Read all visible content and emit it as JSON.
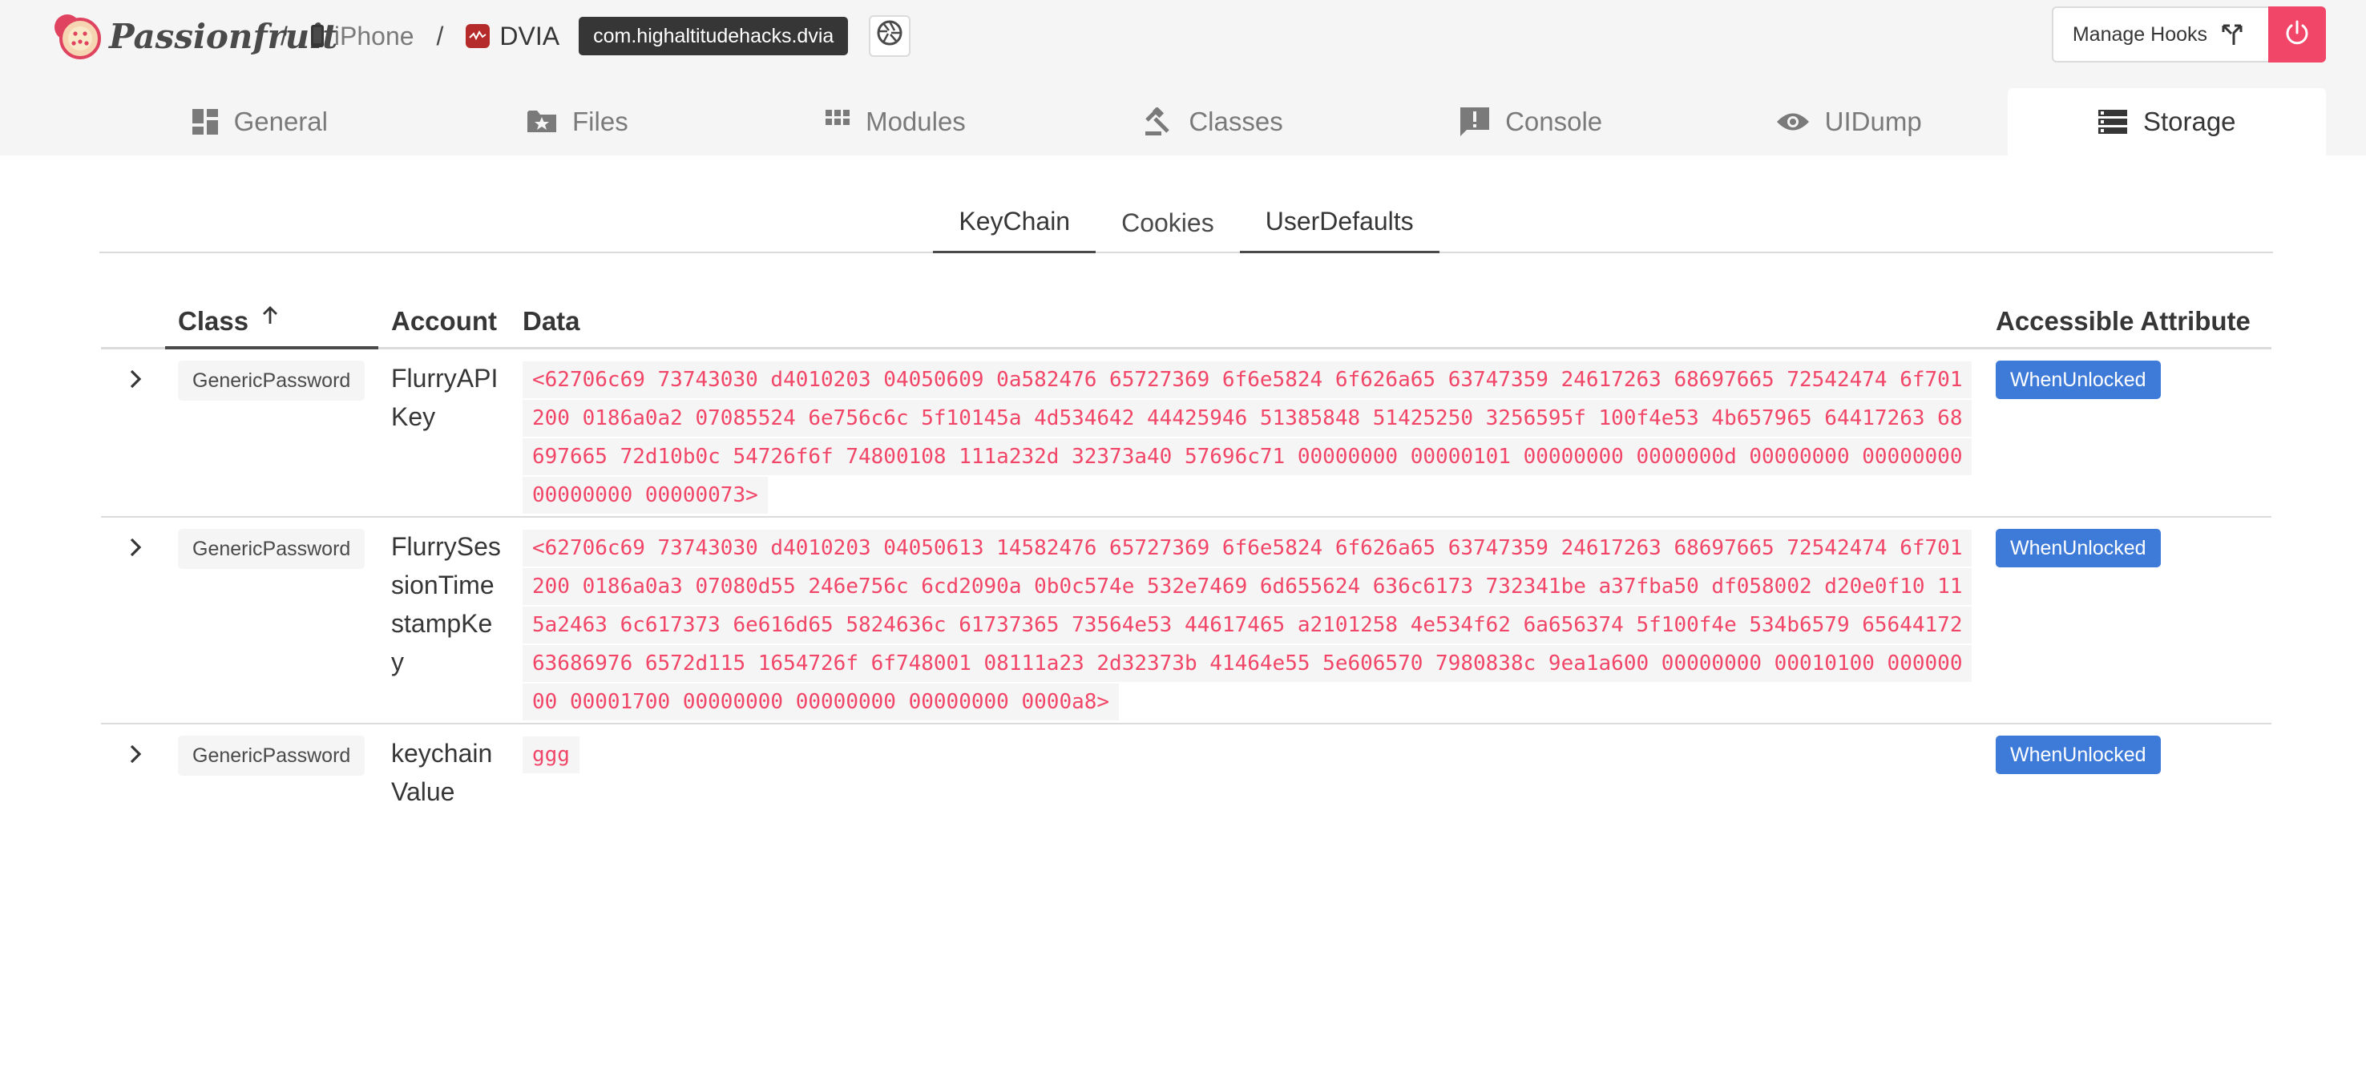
{
  "header": {
    "brand": "Passionfruit",
    "breadcrumbs": [
      {
        "label": "iPhone",
        "icon": "phone-icon"
      },
      {
        "label": "DVIA",
        "icon": "app-icon"
      }
    ],
    "bundle_id": "com.highaltitudehacks.dvia",
    "manage_hooks_label": "Manage Hooks",
    "colors": {
      "danger": "#f14668",
      "link": "#3e7bd9",
      "dark": "#363636"
    }
  },
  "tabs": [
    {
      "label": "General",
      "icon": "dashboard-icon"
    },
    {
      "label": "Files",
      "icon": "folder-star-icon"
    },
    {
      "label": "Modules",
      "icon": "grid-icon"
    },
    {
      "label": "Classes",
      "icon": "gavel-icon"
    },
    {
      "label": "Console",
      "icon": "alert-box-icon"
    },
    {
      "label": "UIDump",
      "icon": "eye-icon"
    },
    {
      "label": "Storage",
      "icon": "storage-icon",
      "active": true
    }
  ],
  "subtabs": [
    {
      "label": "KeyChain",
      "active": true
    },
    {
      "label": "Cookies"
    },
    {
      "label": "UserDefaults"
    }
  ],
  "table": {
    "columns": {
      "class": "Class",
      "account": "Account",
      "data": "Data",
      "accessible": "Accessible Attribute"
    },
    "rows": [
      {
        "class": "GenericPassword",
        "account": "FlurryAPIKey",
        "data": "<62706c69 73743030 d4010203 04050609 0a582476 65727369 6f6e5824 6f626a65 63747359 24617263 68697665 72542474 6f701200 0186a0a2 07085524 6e756c6c 5f10145a 4d534642 44425946 51385848 51425250 3256595f 100f4e53 4b657965 64417263 68697665 72d10b0c 54726f6f 74800108 111a232d 32373a40 57696c71 00000000 00000101 00000000 0000000d 00000000 00000000 00000000 00000073>",
        "accessible": "WhenUnlocked"
      },
      {
        "class": "GenericPassword",
        "account": "FlurrySessionTimestampKey",
        "data": "<62706c69 73743030 d4010203 04050613 14582476 65727369 6f6e5824 6f626a65 63747359 24617263 68697665 72542474 6f701200 0186a0a3 07080d55 246e756c 6cd2090a 0b0c574e 532e7469 6d655624 636c6173 732341be a37fba50 df058002 d20e0f10 115a2463 6c617373 6e616d65 5824636c 61737365 73564e53 44617465 a2101258 4e534f62 6a656374 5f100f4e 534b6579 65644172 63686976 6572d115 1654726f 6f748001 08111a23 2d32373b 41464e55 5e606570 7980838c 9ea1a600 00000000 00010100 00000000 00001700 00000000 00000000 00000000 0000a8>",
        "accessible": "WhenUnlocked"
      },
      {
        "class": "GenericPassword",
        "account": "keychainValue",
        "data": "ggg",
        "accessible": "WhenUnlocked"
      }
    ]
  }
}
